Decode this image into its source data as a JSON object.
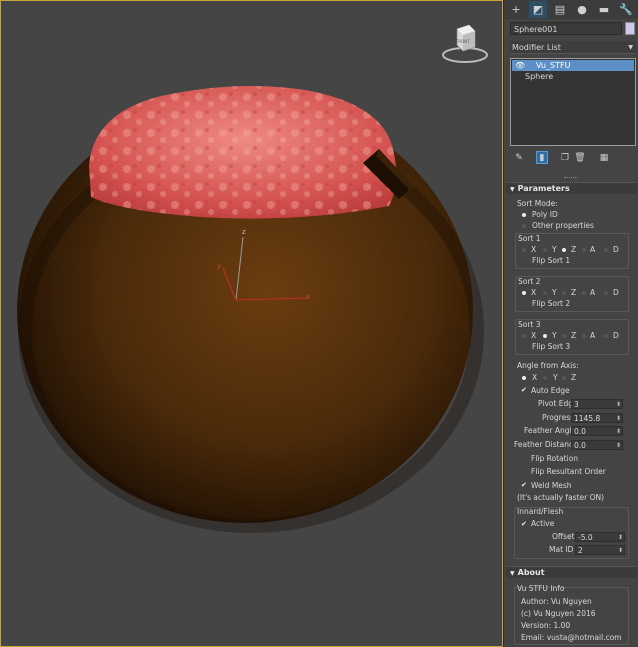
{
  "viewport": {
    "navcube_label": "FRONT",
    "axis_labels": {
      "x": "x",
      "y": "y",
      "z": "z"
    }
  },
  "command_panel": {
    "tabs": [
      {
        "icon": "create-icon",
        "glyph": "+"
      },
      {
        "icon": "modify-icon",
        "glyph": "◩"
      },
      {
        "icon": "hierarchy-icon",
        "glyph": "▤"
      },
      {
        "icon": "motion-icon",
        "glyph": "●"
      },
      {
        "icon": "display-icon",
        "glyph": "▬"
      },
      {
        "icon": "utilities-icon",
        "glyph": "🔧"
      }
    ],
    "object_name": "Sphere001",
    "object_color": "#cdc9ee",
    "modifier_list_label": "Modifier List",
    "stack": {
      "modifier": "Vu_STFU",
      "base": "Sphere"
    }
  },
  "parameters": {
    "title": "Parameters",
    "sort_mode_label": "Sort Mode:",
    "sort_mode_options": [
      "Poly ID",
      "Other properties"
    ],
    "sort_mode_selected": "Poly ID",
    "sort1": {
      "title": "Sort 1",
      "axes": [
        "X",
        "Y",
        "Z",
        "A",
        "D"
      ],
      "selected": "Z",
      "flip_label": "Flip Sort 1"
    },
    "sort2": {
      "title": "Sort 2",
      "axes": [
        "X",
        "Y",
        "Z",
        "A",
        "D"
      ],
      "selected": "X",
      "flip_label": "Flip Sort 2"
    },
    "sort3": {
      "title": "Sort 3",
      "axes": [
        "X",
        "Y",
        "Z",
        "A",
        "D"
      ],
      "selected": "Y",
      "flip_label": "Flip Sort 3"
    },
    "angle_axis_label": "Angle from Axis:",
    "angle_axes": [
      "X",
      "Y",
      "Z"
    ],
    "angle_axis_selected": "X",
    "auto_edge_label": "Auto Edge",
    "pivot_edge_label": "Pivot Edge",
    "pivot_edge_value": "3",
    "progress_label": "Progress",
    "progress_value": "1145.8",
    "feather_angle_label": "Feather Angle",
    "feather_angle_value": "0.0",
    "feather_distance_label": "Feather Distance",
    "feather_distance_value": "0.0",
    "flip_rotation_label": "Flip Rotation",
    "flip_resultant_label": "Flip Resultant Order",
    "weld_mesh_label": "Weld Mesh",
    "weld_note": "(It's actually faster ON)",
    "innard_title": "Innard/Flesh",
    "active_label": "Active",
    "offset_label": "Offset",
    "offset_value": "-5.0",
    "mat_id_label": "Mat ID",
    "mat_id_value": "2"
  },
  "about": {
    "title": "About",
    "group_title": "Vu STFU Info",
    "author": "Author: Vu Nguyen",
    "copyright": "(c) Vu Nguyen 2016",
    "version": "Version: 1.00",
    "email": "Email: vusta@hotmail.com"
  }
}
